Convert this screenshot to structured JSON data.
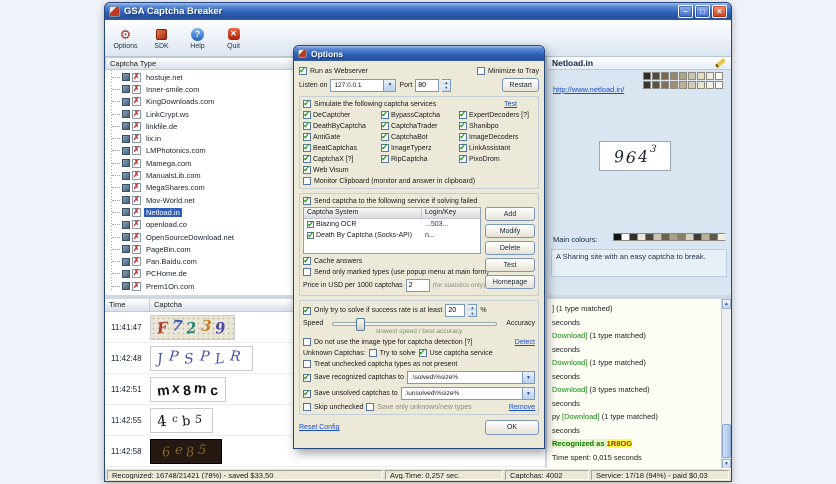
{
  "window": {
    "title": "GSA Captcha Breaker",
    "buttons": {
      "minimize": "–",
      "maximize": "□",
      "close": "×"
    }
  },
  "toolbar": {
    "items": [
      {
        "id": "options",
        "label": "Options",
        "glyph": "⚙"
      },
      {
        "id": "sdk",
        "label": "SDK",
        "glyph": ""
      },
      {
        "id": "help",
        "label": "Help",
        "glyph": "?"
      },
      {
        "id": "quit",
        "label": "Quit",
        "glyph": "✕"
      }
    ]
  },
  "tree": {
    "header": "Captcha Type",
    "items": [
      {
        "label": "hostuje.net",
        "selected": false
      },
      {
        "label": "Inner-smile.com",
        "selected": false
      },
      {
        "label": "KingDownloads.com",
        "selected": false
      },
      {
        "label": "LinkCrypt.ws",
        "selected": false
      },
      {
        "label": "linkfile.de",
        "selected": false
      },
      {
        "label": "lix.in",
        "selected": false
      },
      {
        "label": "LMPhotonics.com",
        "selected": false
      },
      {
        "label": "Mamega.com",
        "selected": false
      },
      {
        "label": "ManualsLib.com",
        "selected": false
      },
      {
        "label": "MegaShares.com",
        "selected": false
      },
      {
        "label": "Mov-World.net",
        "selected": false
      },
      {
        "label": "Netload.in",
        "selected": true
      },
      {
        "label": "openload.co",
        "selected": false
      },
      {
        "label": "OpenSourceDownload.net",
        "selected": false
      },
      {
        "label": "PageBin.com",
        "selected": false
      },
      {
        "label": "Pan.Baidu.com",
        "selected": false
      },
      {
        "label": "PCHome.de",
        "selected": false
      },
      {
        "label": "Prem1On.com",
        "selected": false
      }
    ]
  },
  "info": {
    "title": "Netload.in",
    "url": "http://www.netload.in/",
    "sample_chars": [
      "9",
      "6",
      "4",
      "3"
    ],
    "main_colours_label": "Main colours:",
    "description": "A Sharing site with an easy captcha to break.",
    "top_swatches": [
      "#2e2a24",
      "#55493a",
      "#796852",
      "#98866c",
      "#b5a588",
      "#cfc3a6",
      "#e4dcc4",
      "#f2eddd",
      "#faf7ef",
      "#3a342c",
      "#604f3e",
      "#846f58",
      "#a29072",
      "#bfb092",
      "#d8cdb0",
      "#ebe4cc",
      "#f6f1e2",
      "#fdfbf5"
    ],
    "main_swatches": [
      "#151515",
      "#fefefe",
      "#32302a",
      "#eae6da",
      "#4c463c",
      "#ccc4b4",
      "#6b6254",
      "#aba08a",
      "#8b7f6c",
      "#d9d2c2",
      "#403c34",
      "#bab0a0",
      "#5d564a",
      "#f1ede3"
    ]
  },
  "history": {
    "columns": [
      "Time",
      "Captcha"
    ],
    "rows": [
      {
        "time": "11:41:47",
        "captcha": "F7239",
        "style": "colorful",
        "colors": [
          "#b23a2e",
          "#3a58b2",
          "#2a8078",
          "#c57f2a",
          "#4a4aa2"
        ]
      },
      {
        "time": "11:42:48",
        "captcha": "JPSPLR",
        "style": "serifblue"
      },
      {
        "time": "11:42:51",
        "captcha": "mx8mc",
        "style": "plain"
      },
      {
        "time": "11:42:55",
        "captcha": "4cb5",
        "style": "mixed",
        "sizes": [
          15,
          10,
          13,
          11
        ]
      },
      {
        "time": "11:42:58",
        "captcha": "6e85",
        "style": "dark"
      }
    ]
  },
  "log": {
    "lines": [
      [
        {
          "t": "] (1 type matched)",
          "s": "p"
        }
      ],
      [
        {
          "t": "seconds",
          "s": "p"
        }
      ],
      [
        {
          "t": "Download]",
          "s": "g"
        },
        {
          "t": " (1 type matched)",
          "s": "p"
        }
      ],
      [
        {
          "t": "seconds",
          "s": "p"
        }
      ],
      [
        {
          "t": "Download]",
          "s": "g"
        },
        {
          "t": " (1 type matched)",
          "s": "p"
        }
      ],
      [
        {
          "t": "seconds",
          "s": "p"
        }
      ],
      [
        {
          "t": "Download]",
          "s": "g"
        },
        {
          "t": " (3 types matched)",
          "s": "p"
        }
      ],
      [
        {
          "t": "seconds",
          "s": "p"
        }
      ],
      [
        {
          "t": "py ",
          "s": "p"
        },
        {
          "t": "[Download]",
          "s": "g"
        },
        {
          "t": " (1 type matched)",
          "s": "p"
        }
      ],
      [
        {
          "t": "seconds",
          "s": "p"
        }
      ],
      [
        {
          "t": "Recognized as ",
          "s": "gb"
        },
        {
          "t": "1R8OG",
          "s": "hl"
        }
      ],
      [
        {
          "t": "Time spent: 0,015 seconds",
          "s": "p"
        }
      ]
    ]
  },
  "status": {
    "recognized": "Recognized: 16748/21421 (78%) - saved $33,50",
    "avg_time": "Avg.Time: 0,257 sec.",
    "captchas": "Captchas: 4002",
    "service": "Service: 17/18 (94%) - paid $0,03"
  },
  "dialog": {
    "title": "Options",
    "run_as_webserver": {
      "label": "Run as Webserver",
      "checked": true
    },
    "minimize_to_tray": {
      "label": "Minimize to Tray",
      "checked": false
    },
    "listen_on_label": "Listen on",
    "listen_on_value": "127.0.0.1",
    "port_label": "Port",
    "port_value": "80",
    "restart_label": "Restart",
    "simulate": {
      "label": "Simulate the following captcha services",
      "checked": true
    },
    "test_link": "Test",
    "services": [
      {
        "label": "DeCaptcher",
        "checked": true
      },
      {
        "label": "BypassCaptcha",
        "checked": true
      },
      {
        "label": "ExpertDecoders [?]",
        "checked": true
      },
      {
        "label": "DeathByCaptcha",
        "checked": true
      },
      {
        "label": "CaptchaTrader",
        "checked": true
      },
      {
        "label": "Shanibpo",
        "checked": true
      },
      {
        "label": "AntiGate",
        "checked": true
      },
      {
        "label": "CaptchaBot",
        "checked": true
      },
      {
        "label": "ImageDecoders",
        "checked": true
      },
      {
        "label": "BeatCaptchas",
        "checked": true
      },
      {
        "label": "ImageTyperz",
        "checked": true
      },
      {
        "label": "LinkAssistant",
        "checked": true
      },
      {
        "label": "CaptchaX [?]",
        "checked": true
      },
      {
        "label": "RipCaptcha",
        "checked": true
      },
      {
        "label": "PixoDrom",
        "checked": true
      },
      {
        "label": "Web Visum",
        "checked": true
      }
    ],
    "monitor_clipboard": {
      "label": "Monitor Clipboard (monitor and answer in clipboard)",
      "checked": false
    },
    "send_failed": {
      "label": "Send captcha to the following service if solving failed",
      "checked": true
    },
    "service_table": {
      "columns": [
        "Captcha System",
        "Login/Key"
      ],
      "rows": [
        {
          "checked": true,
          "system": "Blazing OCR",
          "key": "...503..."
        },
        {
          "checked": true,
          "system": "Death By Captcha (Socks-API)",
          "key": "n..."
        }
      ]
    },
    "side_buttons": [
      "Add",
      "Modify",
      "Delete",
      "Test",
      "Homepage"
    ],
    "cache_answers": {
      "label": "Cache answers",
      "checked": true
    },
    "send_only_marked": {
      "label": "Send only marked types (use popup menu at main form)",
      "checked": false
    },
    "price_label": "Price in USD per 1000 captchas",
    "price_value": "2",
    "price_note": "(for statistics only)",
    "success_rate": {
      "label": "Only try to solve if success rate is at least",
      "checked": true,
      "value": "20",
      "suffix": "%"
    },
    "speed_label": "Speed",
    "accuracy_label": "Accuracy",
    "speed_note": "slowest speed / best accuracy",
    "no_image_type": {
      "label": "Do not use the image type for captcha detection [?]",
      "checked": false
    },
    "detect_link": "Detect",
    "unknown_label": "Unknown Captchas:",
    "try_to_solve": {
      "label": "Try to solve",
      "checked": false
    },
    "use_captcha_service": {
      "label": "Use captcha service",
      "checked": true
    },
    "treat_unchecked": {
      "label": "Treat unchecked captcha types as not present",
      "checked": false
    },
    "save_recognized": {
      "label": "Save recognized captchas to",
      "checked": true,
      "value": ".\\solved\\%size%"
    },
    "save_unsolved": {
      "label": "Save unsolved captchas to",
      "checked": true,
      "value": ".\\unsolved\\%size%"
    },
    "skip_unchecked": {
      "label": "Skip unchecked",
      "checked": false
    },
    "save_only_unknown": {
      "label": "Save only unknown/new types",
      "checked": false
    },
    "remove_link": "Remove",
    "reset_link": "Reset Config",
    "ok_label": "OK"
  }
}
